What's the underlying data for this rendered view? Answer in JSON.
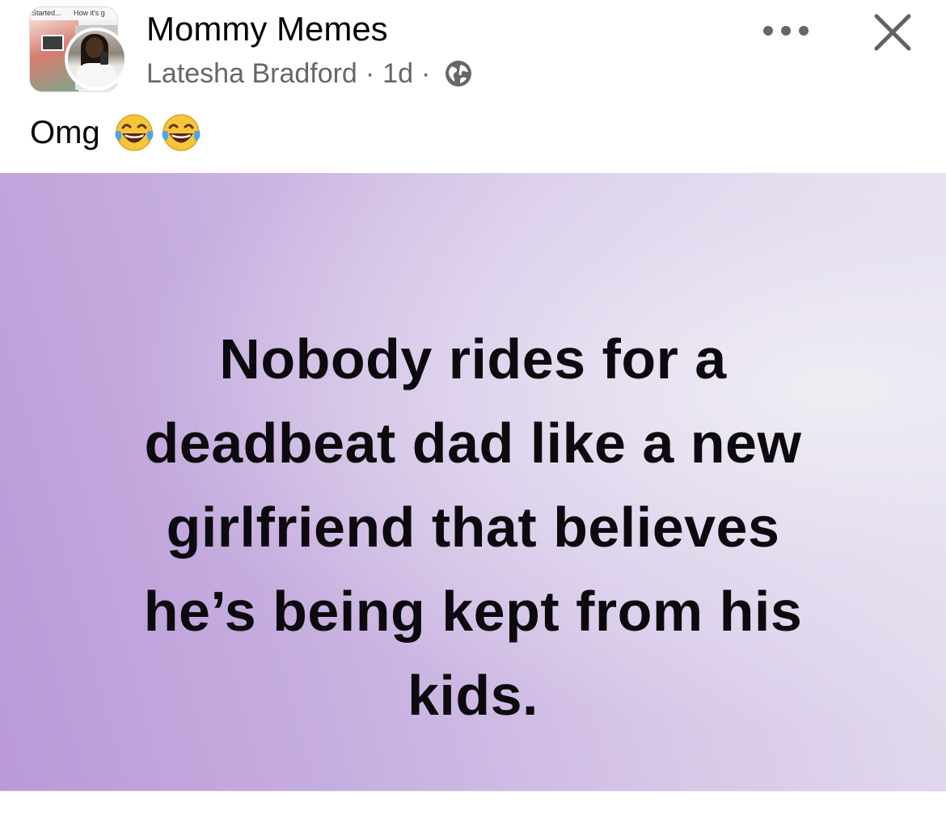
{
  "header": {
    "group_name": "Mommy Memes",
    "author": "Latesha Bradford",
    "separator": "·",
    "time_ago": "1d",
    "privacy_icon": "globe-icon",
    "more_icon": "more-horizontal-icon",
    "close_icon": "close-icon",
    "avatar_strip": [
      "Started...",
      "How it's g"
    ]
  },
  "post": {
    "text": "Omg",
    "emojis": [
      "laughing-with-tears-icon",
      "laughing-with-tears-icon"
    ]
  },
  "meme": {
    "lines": [
      "Nobody rides for a",
      "deadbeat dad like a new",
      "girlfriend that believes",
      "he’s being kept from his",
      "kids."
    ]
  }
}
